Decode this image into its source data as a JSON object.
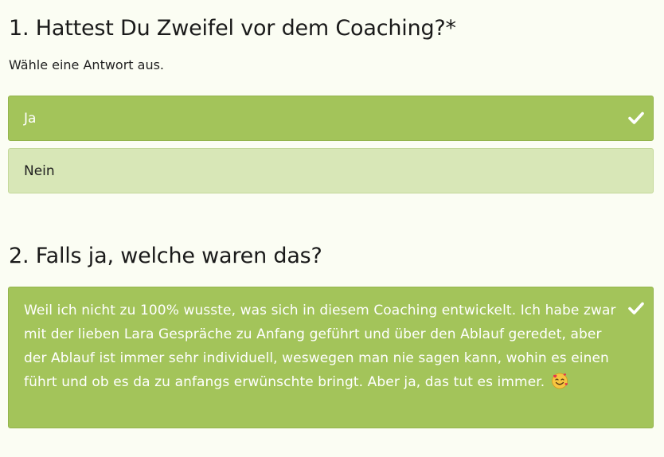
{
  "q1": {
    "title": "1. Hattest Du Zweifel vor dem Coaching?*",
    "hint": "Wähle eine Antwort aus.",
    "options": [
      {
        "label": "Ja",
        "selected": true
      },
      {
        "label": "Nein",
        "selected": false
      }
    ]
  },
  "q2": {
    "title": "2. Falls ja, welche waren das?",
    "answer": "Weil ich nicht zu 100% wusste, was sich in diesem Coaching entwickelt. Ich habe zwar mit der lieben Lara Gespräche zu Anfang geführt und über den Ablauf geredet, aber der Ablauf ist immer sehr individuell, weswegen man nie sagen kann, wohin es einen führt und ob es da zu anfangs erwünschte bringt. Aber ja, das tut es immer.",
    "emoji_icon": "smiling-face-with-hearts-emoji"
  },
  "colors": {
    "selected": "#a3c45a",
    "unselected": "#d8e7b7",
    "background": "#fbfdf3"
  }
}
